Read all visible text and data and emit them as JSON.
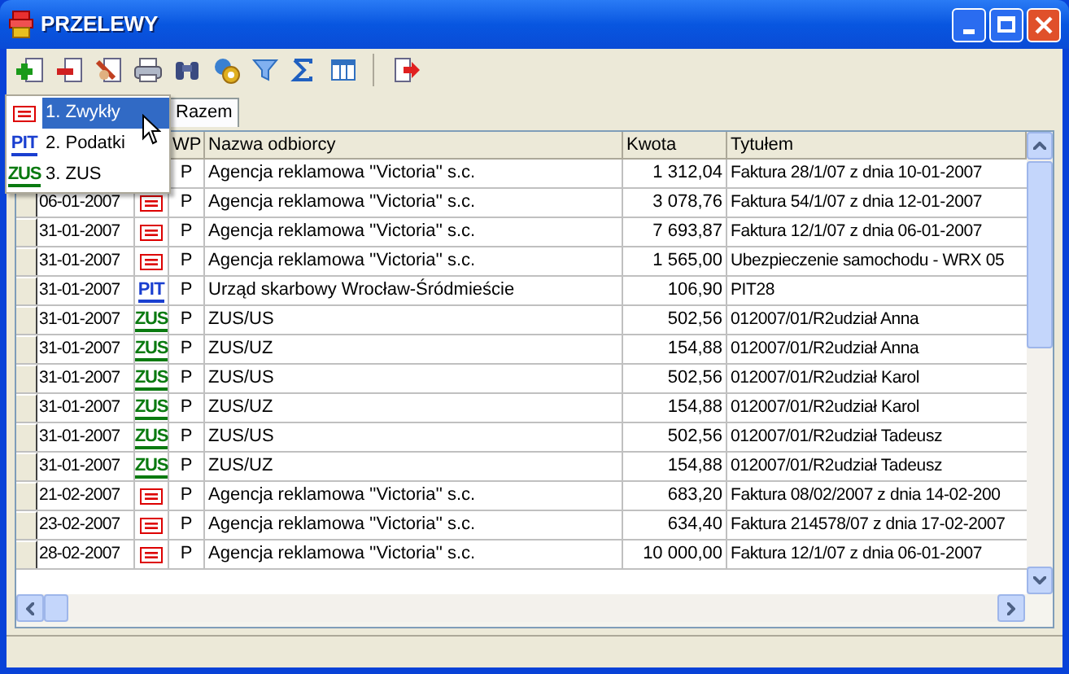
{
  "window": {
    "title": "PRZELEWY"
  },
  "tabs": [
    {
      "label": "Razem"
    }
  ],
  "menu": [
    {
      "kind": "transfer",
      "label": "1. Zwykły",
      "selected": true
    },
    {
      "kind": "tax",
      "badge": "PIT",
      "label": "2. Podatki",
      "selected": false
    },
    {
      "kind": "zus",
      "badge": "ZUS",
      "label": "3. ZUS",
      "selected": false
    }
  ],
  "table": {
    "columns": [
      "WP",
      "Nazwa odbiorcy",
      "Kwota",
      "Tytułem"
    ],
    "rows": [
      {
        "wp": "P",
        "name": "Agencja reklamowa ''Victoria'' s.c.",
        "amount": "1 312,04",
        "title": "Faktura 28/1/07 z dnia 10-01-2007"
      },
      {
        "date": "06-01-2007",
        "kind": "transfer",
        "wp": "P",
        "name": "Agencja reklamowa ''Victoria'' s.c.",
        "amount": "3 078,76",
        "title": "Faktura 54/1/07 z dnia 12-01-2007"
      },
      {
        "date": "31-01-2007",
        "kind": "transfer",
        "wp": "P",
        "name": "Agencja reklamowa ''Victoria'' s.c.",
        "amount": "7 693,87",
        "title": "Faktura 12/1/07 z dnia 06-01-2007"
      },
      {
        "date": "31-01-2007",
        "kind": "transfer",
        "wp": "P",
        "name": "Agencja reklamowa ''Victoria'' s.c.",
        "amount": "1 565,00",
        "title": "Ubezpieczenie samochodu - WRX 05"
      },
      {
        "date": "31-01-2007",
        "kind": "tax",
        "badge": "PIT",
        "wp": "P",
        "name": "Urząd skarbowy Wrocław-Śródmieście",
        "amount": "106,90",
        "title": "PIT28"
      },
      {
        "date": "31-01-2007",
        "kind": "zus",
        "badge": "ZUS",
        "wp": "P",
        "name": "ZUS/US",
        "amount": "502,56",
        "title": "012007/01/R2udział Anna"
      },
      {
        "date": "31-01-2007",
        "kind": "zus",
        "badge": "ZUS",
        "wp": "P",
        "name": "ZUS/UZ",
        "amount": "154,88",
        "title": "012007/01/R2udział Anna"
      },
      {
        "date": "31-01-2007",
        "kind": "zus",
        "badge": "ZUS",
        "wp": "P",
        "name": "ZUS/US",
        "amount": "502,56",
        "title": "012007/01/R2udział Karol"
      },
      {
        "date": "31-01-2007",
        "kind": "zus",
        "badge": "ZUS",
        "wp": "P",
        "name": "ZUS/UZ",
        "amount": "154,88",
        "title": "012007/01/R2udział Karol"
      },
      {
        "date": "31-01-2007",
        "kind": "zus",
        "badge": "ZUS",
        "wp": "P",
        "name": "ZUS/US",
        "amount": "502,56",
        "title": "012007/01/R2udział Tadeusz"
      },
      {
        "date": "31-01-2007",
        "kind": "zus",
        "badge": "ZUS",
        "wp": "P",
        "name": "ZUS/UZ",
        "amount": "154,88",
        "title": "012007/01/R2udział Tadeusz"
      },
      {
        "date": "21-02-2007",
        "kind": "transfer",
        "wp": "P",
        "name": "Agencja reklamowa ''Victoria'' s.c.",
        "amount": "683,20",
        "title": "Faktura 08/02/2007 z dnia 14-02-200"
      },
      {
        "date": "23-02-2007",
        "kind": "transfer",
        "wp": "P",
        "name": "Agencja reklamowa ''Victoria'' s.c.",
        "amount": "634,40",
        "title": "Faktura 214578/07 z dnia 17-02-2007"
      },
      {
        "date": "28-02-2007",
        "kind": "transfer",
        "wp": "P",
        "name": "Agencja reklamowa ''Victoria'' s.c.",
        "amount": "10 000,00",
        "title": "Faktura 12/1/07 z dnia 06-01-2007"
      }
    ]
  }
}
